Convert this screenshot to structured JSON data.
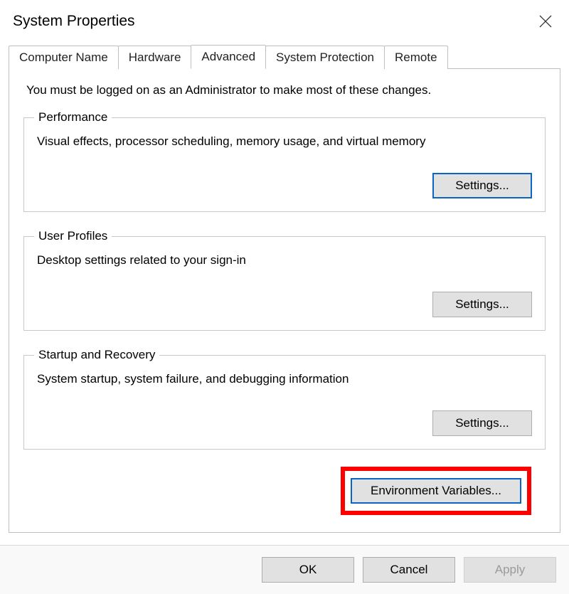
{
  "window": {
    "title": "System Properties"
  },
  "tabs": {
    "items": [
      {
        "label": "Computer Name"
      },
      {
        "label": "Hardware"
      },
      {
        "label": "Advanced"
      },
      {
        "label": "System Protection"
      },
      {
        "label": "Remote"
      }
    ],
    "active_index": 2
  },
  "panel": {
    "admin_note": "You must be logged on as an Administrator to make most of these changes.",
    "groups": {
      "performance": {
        "legend": "Performance",
        "desc": "Visual effects, processor scheduling, memory usage, and virtual memory",
        "button": "Settings..."
      },
      "user_profiles": {
        "legend": "User Profiles",
        "desc": "Desktop settings related to your sign-in",
        "button": "Settings..."
      },
      "startup_recovery": {
        "legend": "Startup and Recovery",
        "desc": "System startup, system failure, and debugging information",
        "button": "Settings..."
      }
    },
    "env_button": "Environment Variables..."
  },
  "footer": {
    "ok": "OK",
    "cancel": "Cancel",
    "apply": "Apply"
  }
}
